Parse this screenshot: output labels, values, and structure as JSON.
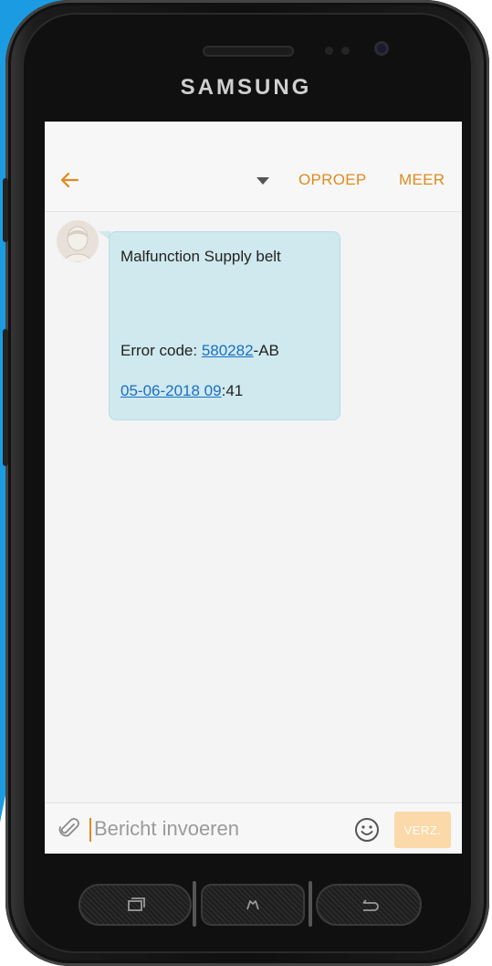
{
  "device": {
    "brand": "SAMSUNG"
  },
  "appbar": {
    "back_icon": "arrow-left-icon",
    "dropdown_icon": "caret-down-icon",
    "call_label": "OPROEP",
    "more_label": "MEER"
  },
  "message": {
    "title": "Malfunction Supply belt",
    "code_prefix": "Error code: ",
    "code_link": "580282",
    "code_suffix": "-AB",
    "time_link": "05-06-2018 09",
    "time_suffix": ":41"
  },
  "composer": {
    "placeholder": "Bericht invoeren",
    "send_label": "VERZ.",
    "attach_icon": "paperclip-icon",
    "emoji_icon": "smiley-icon"
  },
  "hardware_keys": {
    "recent_icon": "recent-apps-icon",
    "home_icon": "home-icon",
    "back_icon": "back-icon"
  },
  "colors": {
    "accent": "#e08a1e",
    "bubble": "#cfe9ee",
    "link": "#1a6fc4",
    "send_disabled": "#fbd9a9",
    "backdrop_blue": "#1b9ce2"
  }
}
